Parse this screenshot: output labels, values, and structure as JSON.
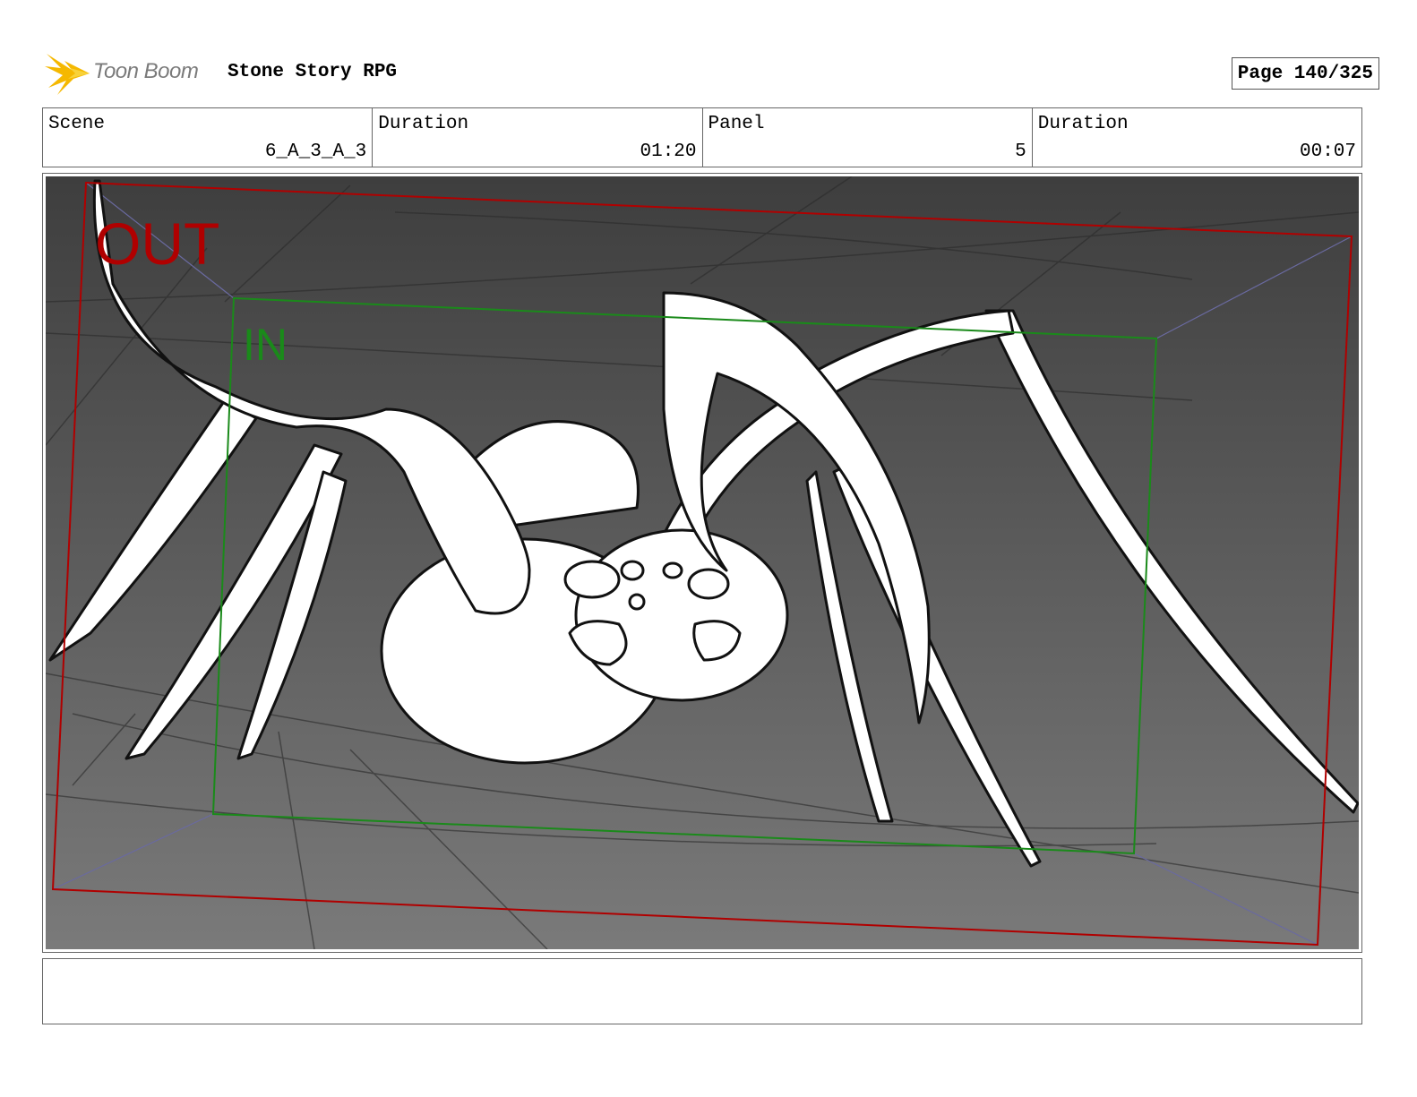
{
  "header": {
    "logo_text": "Toon Boom",
    "project_title": "Stone Story RPG",
    "page_label": "Page 140/325"
  },
  "info": {
    "scene_label": "Scene",
    "scene_value": "6_A_3_A_3",
    "scene_duration_label": "Duration",
    "scene_duration_value": "01:20",
    "panel_label": "Panel",
    "panel_value": "5",
    "panel_duration_label": "Duration",
    "panel_duration_value": "00:07"
  },
  "panel": {
    "out_label": "OUT",
    "in_label": "IN",
    "colors": {
      "out_frame": "#b00000",
      "in_frame": "#1a8a1a",
      "guide": "#6a6aa0"
    }
  },
  "notes": {
    "text": ""
  }
}
